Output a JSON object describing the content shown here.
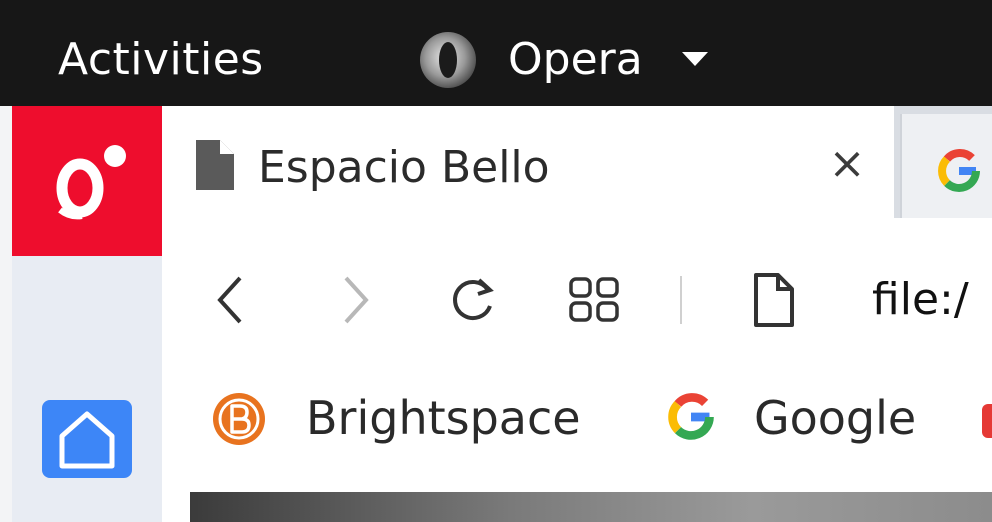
{
  "topbar": {
    "activities_label": "Activities",
    "app_name": "Opera",
    "app_icon": "opera-icon",
    "menu_icon": "triangle-down-icon"
  },
  "sidebar": {
    "logo_icon": "opera-gx-logo-icon",
    "home_icon": "home-icon",
    "accent_color": "#ee0d2d",
    "home_color": "#3d86f7"
  },
  "tabs": [
    {
      "title": "Espacio Bello",
      "icon": "file-icon",
      "active": true,
      "close_label": "×"
    },
    {
      "title": "",
      "icon": "google-g-icon",
      "active": false
    }
  ],
  "toolbar": {
    "back_icon": "chevron-left-icon",
    "forward_icon": "chevron-right-icon",
    "reload_icon": "reload-icon",
    "tabs_grid_icon": "grid-icon",
    "page_icon": "page-icon",
    "address": "file:/"
  },
  "bookmarks": [
    {
      "label": "Brightspace",
      "icon": "brightspace-icon"
    },
    {
      "label": "Google",
      "icon": "google-g-icon"
    }
  ]
}
